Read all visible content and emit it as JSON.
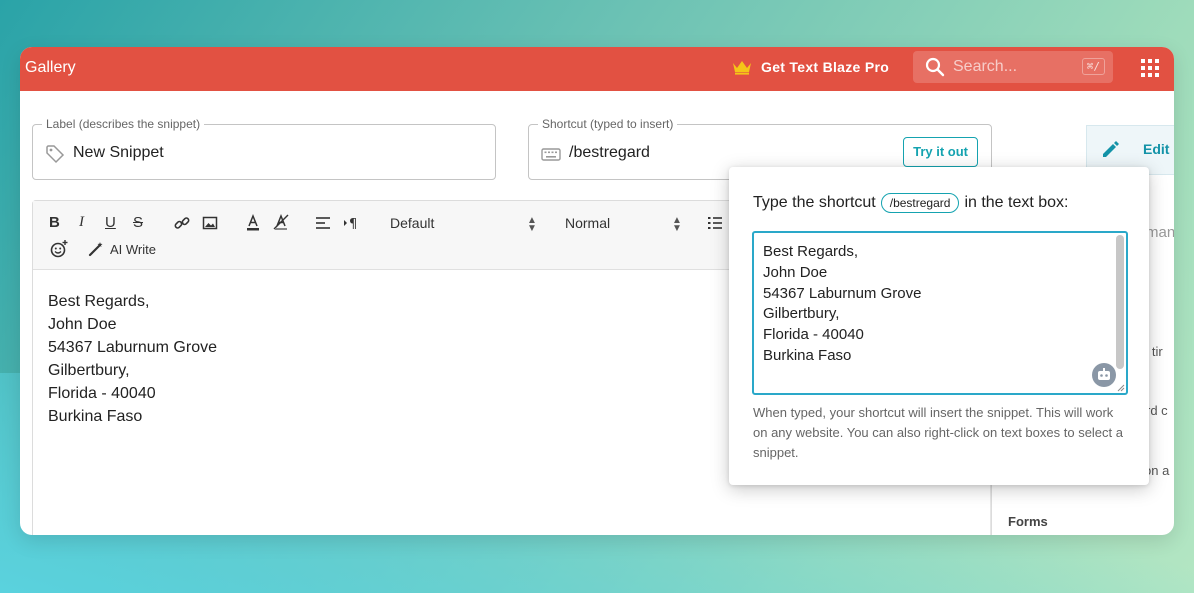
{
  "header": {
    "title": "Gallery",
    "pro_label": "Get Text Blaze Pro",
    "search_placeholder": "Search...",
    "search_shortcut": "⌘/"
  },
  "label_field": {
    "legend": "Label (describes the snippet)",
    "value": "New Snippet"
  },
  "shortcut_field": {
    "legend": "Shortcut (typed to insert)",
    "value": "/bestregard",
    "try_label": "Try it out"
  },
  "side_panel": {
    "edit_label": "Edit",
    "fragments": [
      "man",
      "d tir",
      "rd c",
      "on a"
    ],
    "forms_label": "Forms"
  },
  "toolbar": {
    "bold": "B",
    "italic": "I",
    "underline": "U",
    "strike": "S",
    "font_select": "Default",
    "size_select": "Normal",
    "ai_write": "AI Write"
  },
  "editor": {
    "lines": [
      "Best Regards,",
      "John Doe",
      "54367 Laburnum Grove",
      "Gilbertbury,",
      "Florida - 40040",
      "Burkina Faso"
    ]
  },
  "popover": {
    "instruction_before": "Type the shortcut",
    "shortcut": "/bestregard",
    "instruction_after": "in the text box:",
    "test_text": "Best Regards,\nJohn Doe\n54367 Laburnum Grove\nGilbertbury,\nFlorida - 40040\nBurkina Faso",
    "help": "When typed, your shortcut will insert the snippet. This will work on any website. You can also right-click on text boxes to select a snippet."
  },
  "colors": {
    "header": "#e25142",
    "accent": "#15a3b0",
    "crown": "#f5c518"
  }
}
